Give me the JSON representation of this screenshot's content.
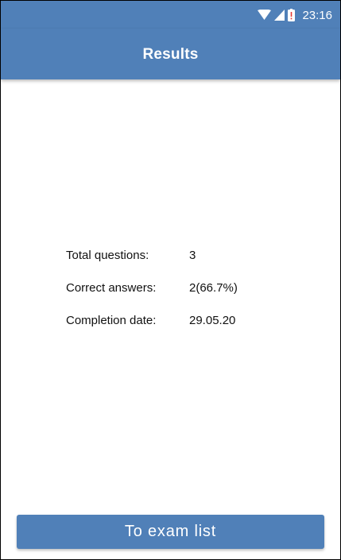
{
  "status_bar": {
    "time": "23:16",
    "icons": [
      "wifi-icon",
      "signal-icon",
      "battery-alert-icon"
    ],
    "background_color": "#5080b8"
  },
  "app_bar": {
    "title": "Results",
    "background_color": "#5080b8"
  },
  "results": {
    "rows": [
      {
        "label": "Total questions:",
        "value": "3"
      },
      {
        "label": "Correct answers:",
        "value": "2(66.7%)"
      },
      {
        "label": "Completion date:",
        "value": "29.05.20"
      }
    ]
  },
  "footer": {
    "button_label": "To exam list",
    "accent_color": "#5080b8"
  }
}
